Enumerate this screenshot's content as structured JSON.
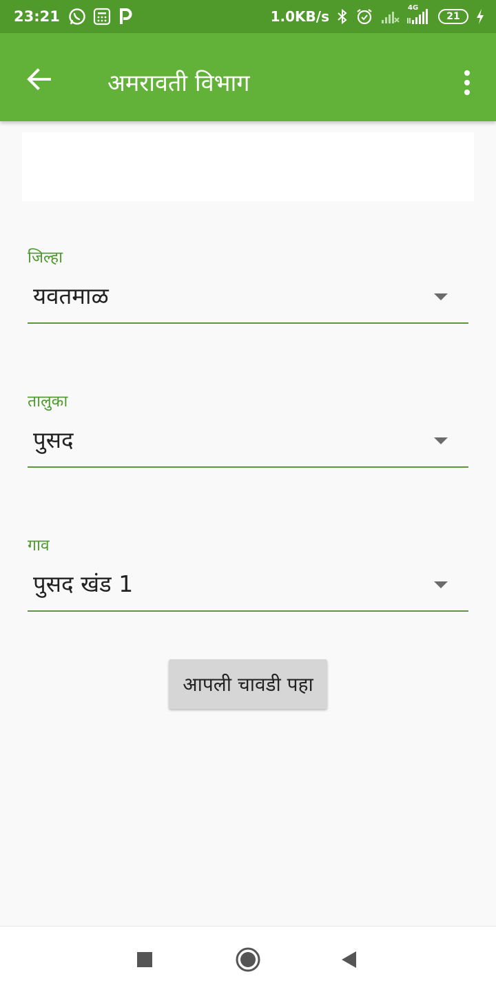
{
  "status_bar": {
    "time": "23:21",
    "net_speed": "1.0KB/s",
    "network": "4G",
    "battery": "21",
    "icons": [
      "whatsapp-icon",
      "calculator-icon",
      "p-icon",
      "bluetooth-icon",
      "alarm-icon",
      "signal-icon",
      "charging-icon"
    ]
  },
  "app_bar": {
    "title": "अमरावती विभाग",
    "back_icon": "arrow-left-icon",
    "menu_icon": "more-vert-icon"
  },
  "form": {
    "district": {
      "label": "जिल्हा",
      "value": "यवतमाळ"
    },
    "taluka": {
      "label": "तालुका",
      "value": "पुसद"
    },
    "village": {
      "label": "गाव",
      "value": "पुसद खंड 1"
    },
    "submit_label": "आपली चावडी पहा"
  },
  "colors": {
    "status_bar": "#4f9a2a",
    "app_bar": "#62b239",
    "accent": "#4e9a2e"
  },
  "nav_bar": {
    "icons": [
      "recent-apps-icon",
      "home-icon",
      "back-triangle-icon"
    ]
  }
}
